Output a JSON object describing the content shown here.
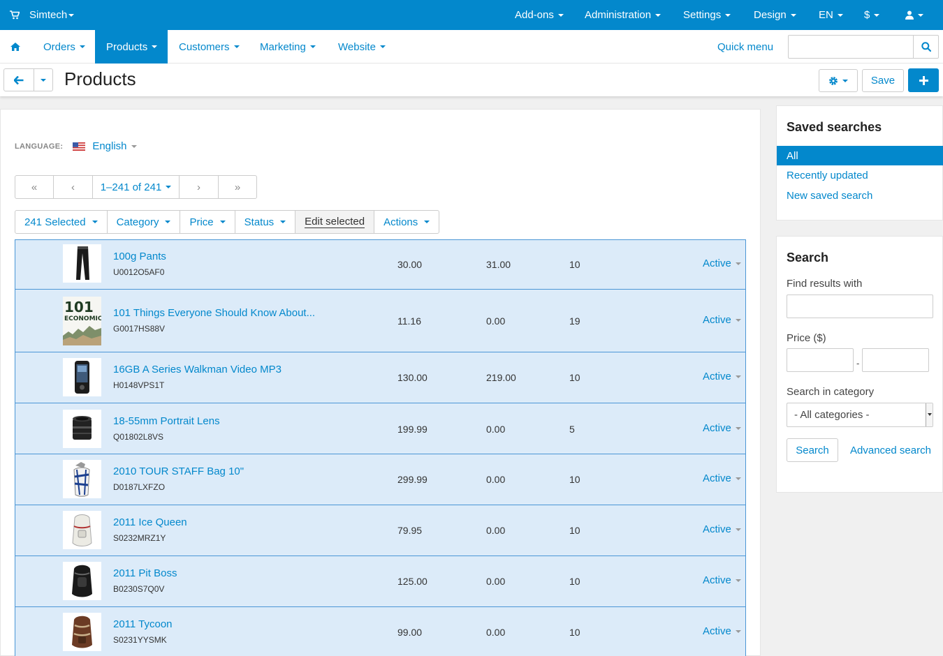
{
  "topbar": {
    "brand": "Simtech",
    "menus": [
      "Add-ons",
      "Administration",
      "Settings",
      "Design",
      "EN",
      "$"
    ]
  },
  "nav": {
    "items": [
      "Orders",
      "Products",
      "Customers",
      "Marketing",
      "Website"
    ],
    "active": "Products",
    "quick_menu": "Quick menu",
    "search_value": ""
  },
  "title": {
    "page_title": "Products",
    "save_label": "Save"
  },
  "language": {
    "label": "LANGUAGE:",
    "value": "English"
  },
  "pagination": {
    "first": "«",
    "prev": "‹",
    "range": "1–241 of 241",
    "next": "›",
    "last": "»"
  },
  "toolbar": {
    "selected": "241 Selected",
    "category": "Category",
    "price": "Price",
    "status": "Status",
    "edit_selected": "Edit selected",
    "actions": "Actions"
  },
  "products": [
    {
      "name": "100g Pants",
      "code": "U0012O5AF0",
      "price": "30.00",
      "list_price": "31.00",
      "qty": "10",
      "status": "Active",
      "thumb": "pants"
    },
    {
      "name": "101 Things Everyone Should Know About...",
      "code": "G0017HS88V",
      "price": "11.16",
      "list_price": "0.00",
      "qty": "19",
      "status": "Active",
      "thumb": "book"
    },
    {
      "name": "16GB A Series Walkman Video MP3",
      "code": "H0148VPS1T",
      "price": "130.00",
      "list_price": "219.00",
      "qty": "10",
      "status": "Active",
      "thumb": "player"
    },
    {
      "name": "18-55mm Portrait Lens",
      "code": "Q01802L8VS",
      "price": "199.99",
      "list_price": "0.00",
      "qty": "5",
      "status": "Active",
      "thumb": "lens"
    },
    {
      "name": "2010 TOUR STAFF Bag 10\"",
      "code": "D0187LXFZO",
      "price": "299.99",
      "list_price": "0.00",
      "qty": "10",
      "status": "Active",
      "thumb": "golfbag"
    },
    {
      "name": "2011 Ice Queen",
      "code": "S0232MRZ1Y",
      "price": "79.95",
      "list_price": "0.00",
      "qty": "10",
      "status": "Active",
      "thumb": "backpack-white"
    },
    {
      "name": "2011 Pit Boss",
      "code": "B0230S7Q0V",
      "price": "125.00",
      "list_price": "0.00",
      "qty": "10",
      "status": "Active",
      "thumb": "backpack-black"
    },
    {
      "name": "2011 Tycoon",
      "code": "S0231YYSMK",
      "price": "99.00",
      "list_price": "0.00",
      "qty": "10",
      "status": "Active",
      "thumb": "backpack-brown"
    }
  ],
  "book_cover_text": {
    "line1": "101",
    "line2": "ECONOMICS"
  },
  "saved_searches": {
    "title": "Saved searches",
    "items": [
      "All",
      "Recently updated",
      "New saved search"
    ],
    "active": "All"
  },
  "search_panel": {
    "title": "Search",
    "find_label": "Find results with",
    "find_value": "",
    "price_label": "Price ($)",
    "price_from": "",
    "price_sep": "-",
    "price_to": "",
    "category_label": "Search in category",
    "category_value": "- All categories -",
    "search_button": "Search",
    "advanced_link": "Advanced search"
  },
  "colors": {
    "accent": "#0388cc",
    "row_selected_bg": "#dcebf9",
    "row_selected_border": "#4a96d6"
  }
}
